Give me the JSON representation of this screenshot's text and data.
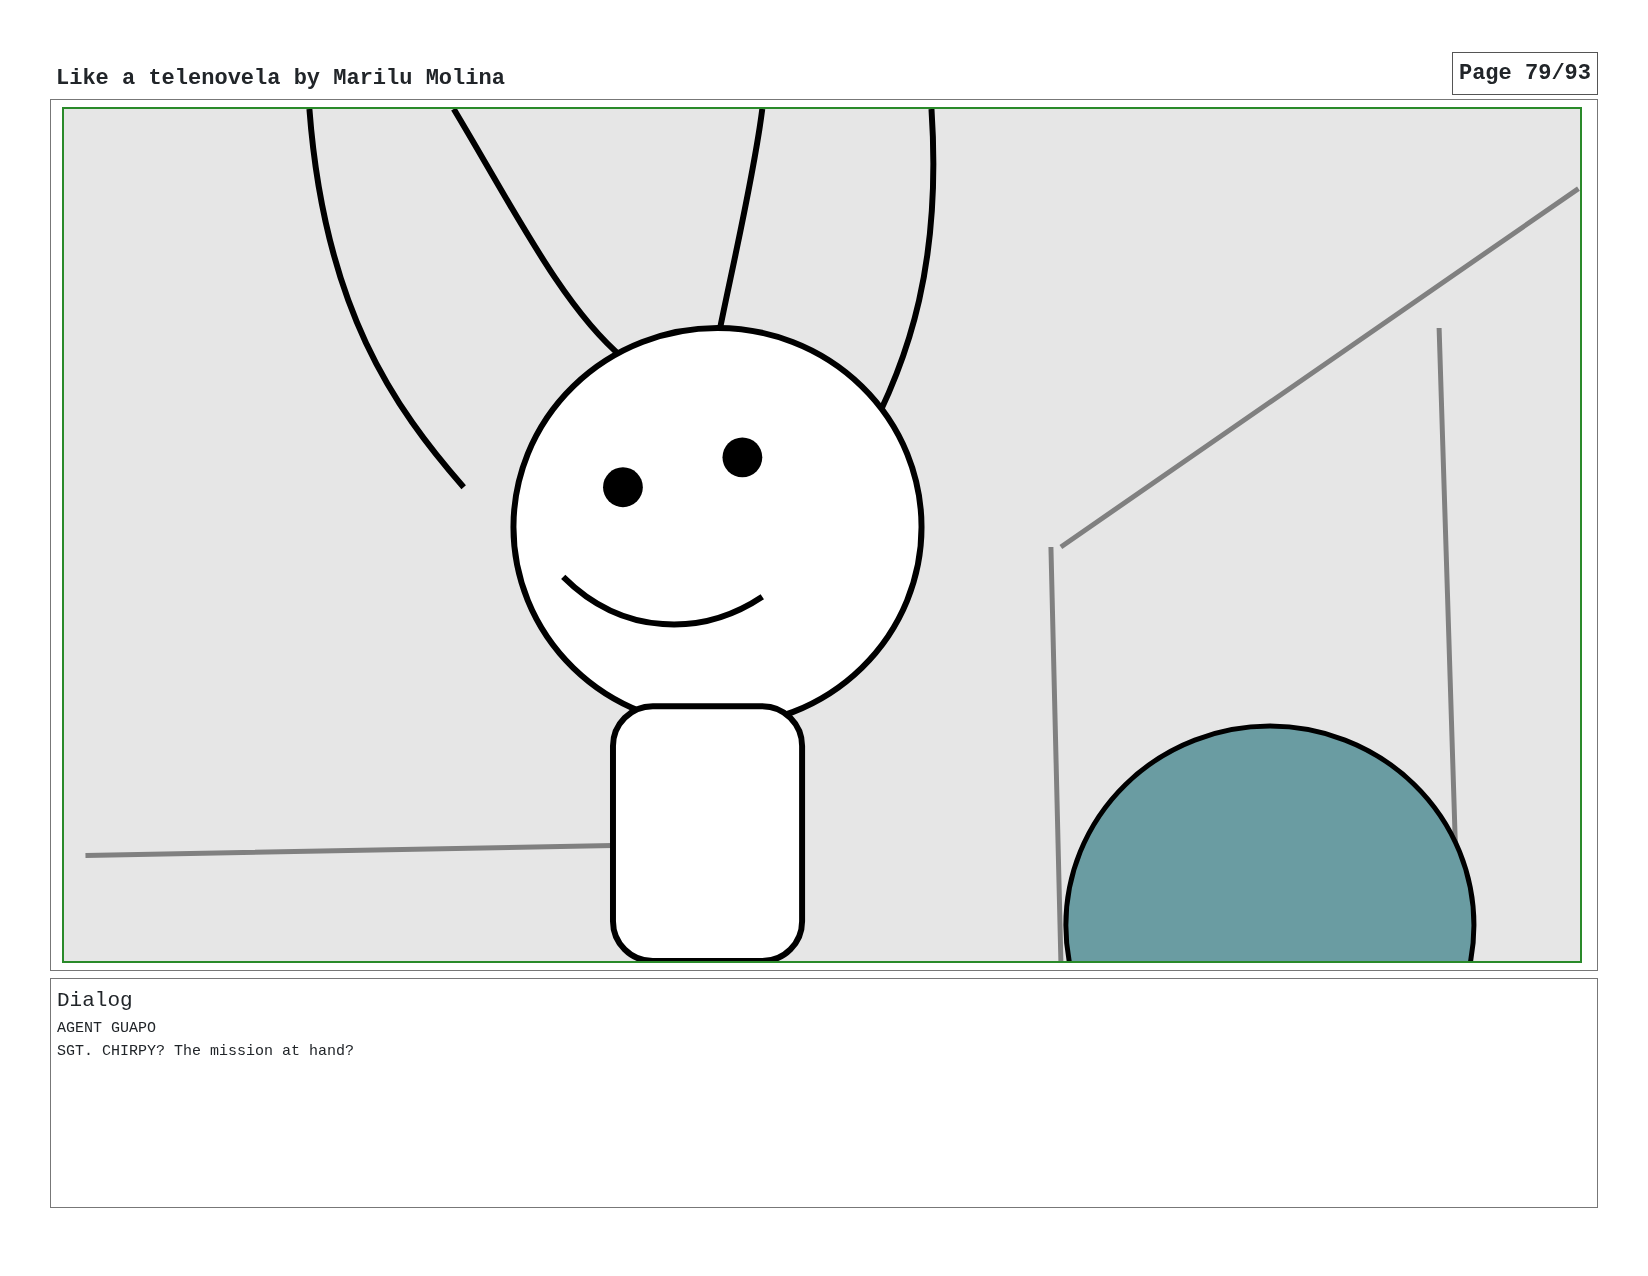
{
  "header": {
    "title": "Like a telenovela by Marilu Molina",
    "page": "Page 79/93"
  },
  "dialog": {
    "heading": "Dialog",
    "lines": [
      "AGENT GUAPO",
      "SGT. CHIRPY? The mission at hand?"
    ]
  }
}
